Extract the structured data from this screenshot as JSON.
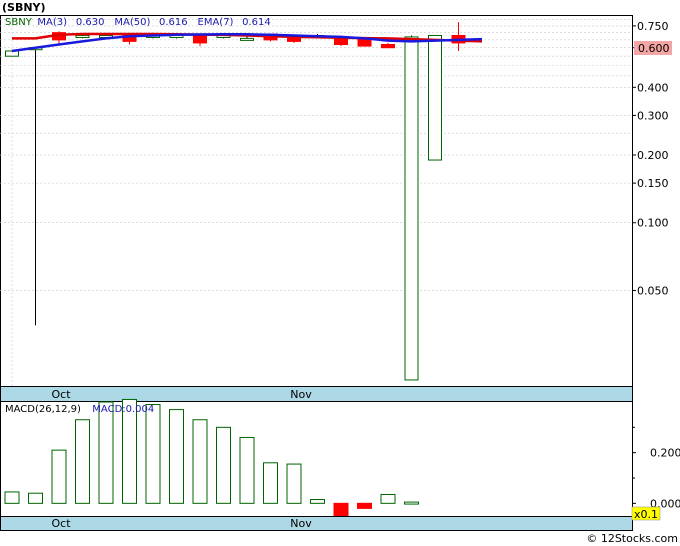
{
  "header": {
    "title": "(SBNY)"
  },
  "credit": "© 12Stocks.com",
  "legend_price": [
    {
      "text": "SBNY",
      "color": "#006400"
    },
    {
      "text": "MA(3)",
      "color": "#1a1aaa"
    },
    {
      "text": "0.630",
      "color": "#1a1aaa"
    },
    {
      "text": "MA(50)",
      "color": "#1a1aaa"
    },
    {
      "text": "0.616",
      "color": "#1a1aaa"
    },
    {
      "text": "EMA(7)",
      "color": "#1a1aaa"
    },
    {
      "text": "0.614",
      "color": "#1a1aaa"
    }
  ],
  "legend_macd": [
    {
      "text": "MACD(26,12,9)",
      "color": "#000000"
    },
    {
      "text": "MACD:0.004",
      "color": "#1a1aaa"
    }
  ],
  "colors": {
    "up": "#006400",
    "down": "#ff0000",
    "ma_red": "#e00000",
    "ma_blue": "#1a1add",
    "axis_band": "#add8e6",
    "price_tag": "#f4a6a6",
    "scale_tag": "#ffff00"
  },
  "chart_data": [
    {
      "type": "candlestick",
      "y_scale": "log",
      "ylim": [
        0.0188,
        0.83
      ],
      "y_ticks": [
        "0.750",
        "0.600",
        "0.400",
        "0.300",
        "0.200",
        "0.150",
        "0.100",
        "0.050"
      ],
      "x_ticks": [
        "Oct",
        "Nov"
      ],
      "last_price": "0.600",
      "candles": [
        {
          "o": 0.55,
          "h": 0.58,
          "l": 0.55,
          "c": 0.58
        },
        {
          "o": 0.6,
          "h": 0.6,
          "l": 0.035,
          "c": 0.6
        },
        {
          "o": 0.7,
          "h": 0.71,
          "l": 0.62,
          "c": 0.65
        },
        {
          "o": 0.68,
          "h": 0.69,
          "l": 0.66,
          "c": 0.68
        },
        {
          "o": 0.68,
          "h": 0.69,
          "l": 0.66,
          "c": 0.68
        },
        {
          "o": 0.68,
          "h": 0.69,
          "l": 0.62,
          "c": 0.64
        },
        {
          "o": 0.68,
          "h": 0.69,
          "l": 0.66,
          "c": 0.68
        },
        {
          "o": 0.68,
          "h": 0.69,
          "l": 0.66,
          "c": 0.68
        },
        {
          "o": 0.68,
          "h": 0.69,
          "l": 0.61,
          "c": 0.63
        },
        {
          "o": 0.68,
          "h": 0.69,
          "l": 0.66,
          "c": 0.68
        },
        {
          "o": 0.66,
          "h": 0.69,
          "l": 0.65,
          "c": 0.66
        },
        {
          "o": 0.69,
          "h": 0.69,
          "l": 0.64,
          "c": 0.65
        },
        {
          "o": 0.67,
          "h": 0.68,
          "l": 0.63,
          "c": 0.64
        },
        {
          "o": 0.68,
          "h": 0.69,
          "l": 0.66,
          "c": 0.68
        },
        {
          "o": 0.66,
          "h": 0.68,
          "l": 0.61,
          "c": 0.62
        },
        {
          "o": 0.66,
          "h": 0.67,
          "l": 0.61,
          "c": 0.61
        },
        {
          "o": 0.62,
          "h": 0.63,
          "l": 0.6,
          "c": 0.6
        },
        {
          "o": 0.02,
          "h": 0.68,
          "l": 0.02,
          "c": 0.67
        },
        {
          "o": 0.19,
          "h": 0.68,
          "l": 0.19,
          "c": 0.68
        },
        {
          "o": 0.68,
          "h": 0.78,
          "l": 0.58,
          "c": 0.63
        }
      ],
      "ma_red": [
        0.66,
        0.66,
        0.685,
        0.69,
        0.69,
        0.69,
        0.69,
        0.688,
        0.686,
        0.684,
        0.68,
        0.675,
        0.67,
        0.668,
        0.665,
        0.662,
        0.66,
        0.655,
        0.65,
        0.645,
        0.64
      ],
      "ma_blue": [
        0.58,
        0.6,
        0.62,
        0.64,
        0.66,
        0.675,
        0.68,
        0.685,
        0.687,
        0.688,
        0.688,
        0.685,
        0.68,
        0.675,
        0.67,
        0.66,
        0.645,
        0.64,
        0.645,
        0.65,
        0.655
      ]
    },
    {
      "type": "bar",
      "title": "MACD(26,12,9)",
      "ylim": [
        -0.05,
        0.4
      ],
      "y_ticks": [
        "0.200",
        "0.000"
      ],
      "x_ticks": [
        "Oct",
        "Nov"
      ],
      "scale_note": "x0.1",
      "values": [
        0.045,
        0.04,
        0.21,
        0.33,
        0.4,
        0.41,
        0.39,
        0.37,
        0.33,
        0.3,
        0.26,
        0.16,
        0.155,
        0.015,
        -0.09,
        -0.02,
        0.035,
        0.005
      ]
    }
  ]
}
